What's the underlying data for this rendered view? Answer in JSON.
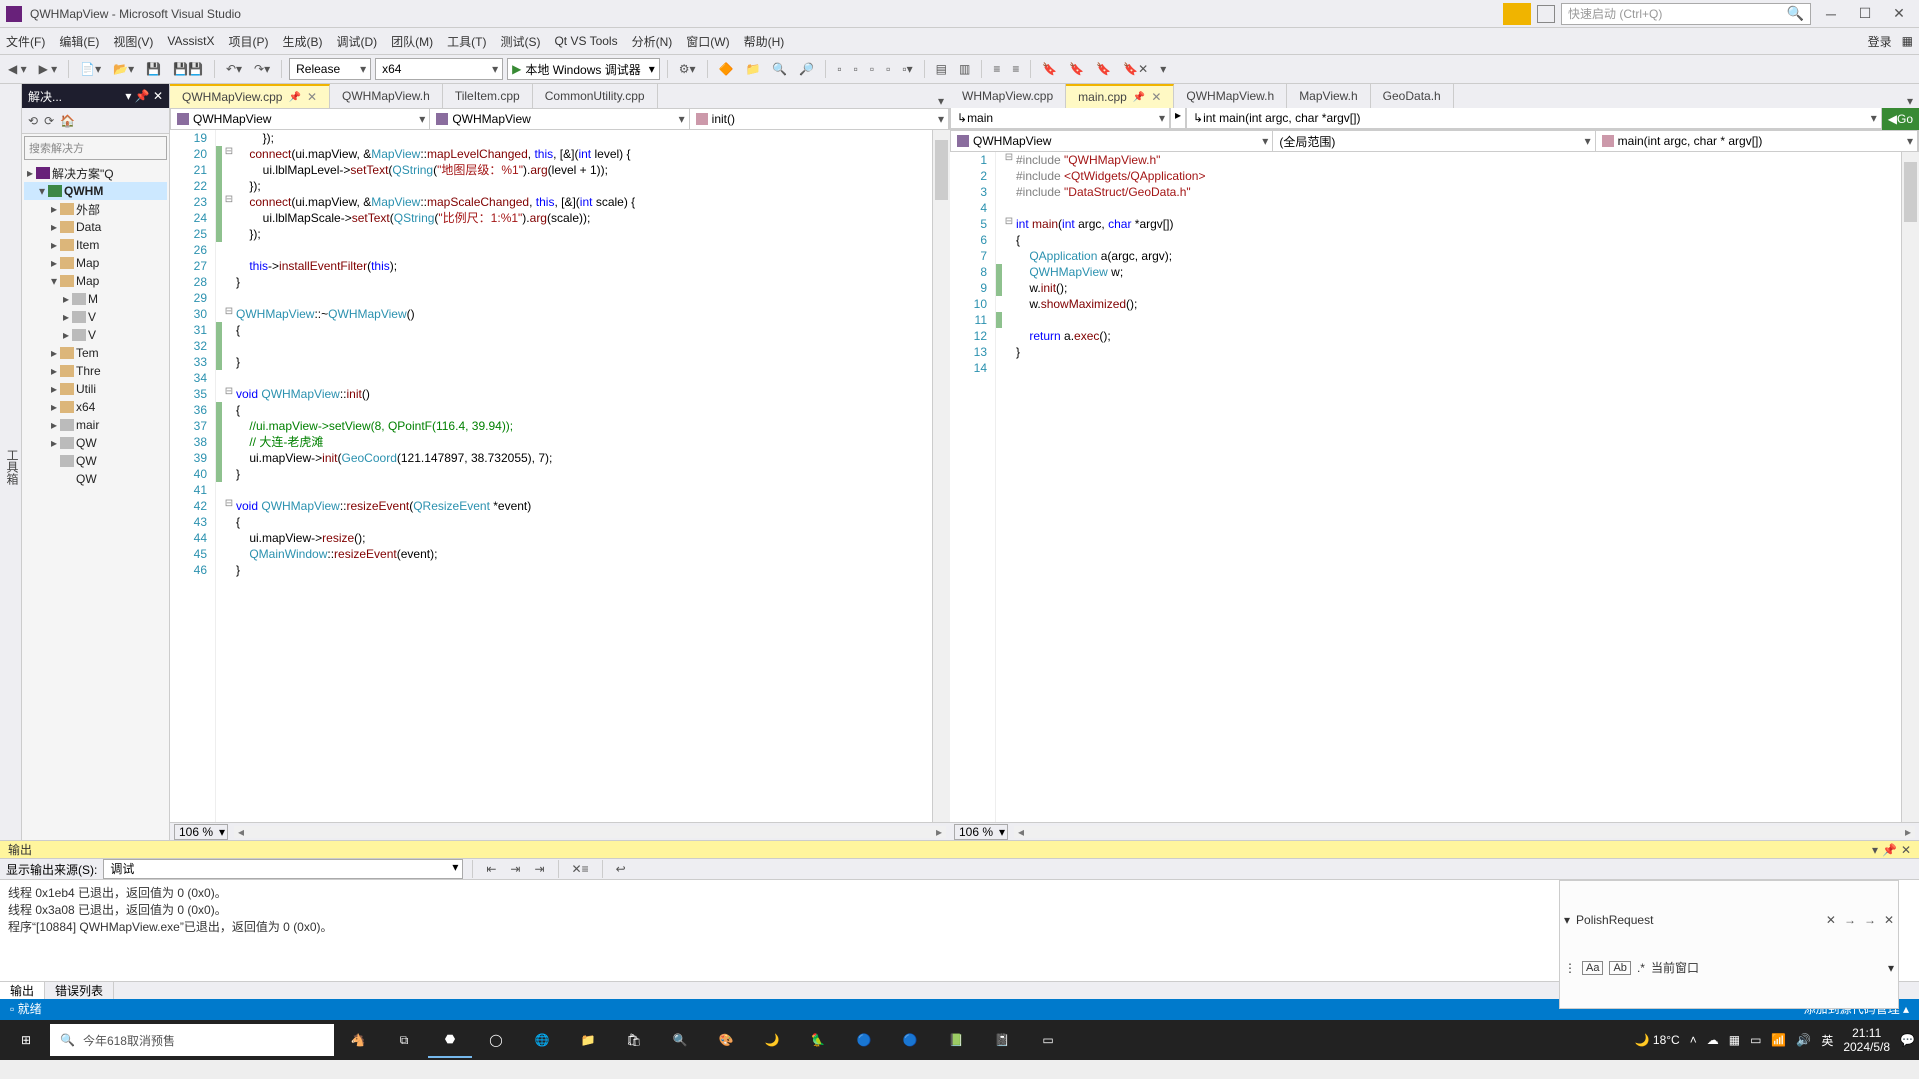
{
  "title": "QWHMapView - Microsoft Visual Studio",
  "quick_launch_placeholder": "快速启动 (Ctrl+Q)",
  "menu": [
    "文件(F)",
    "编辑(E)",
    "视图(V)",
    "VAssistX",
    "项目(P)",
    "生成(B)",
    "调试(D)",
    "团队(M)",
    "工具(T)",
    "测试(S)",
    "Qt VS Tools",
    "分析(N)",
    "窗口(W)",
    "帮助(H)"
  ],
  "login": "登录",
  "toolbar": {
    "config": "Release",
    "platform": "x64",
    "debugger": "本地 Windows 调试器"
  },
  "side_toolbox": "工具箱",
  "solution": {
    "tab": "解决...",
    "search_ph": "搜索解决方",
    "items": [
      {
        "d": 0,
        "exp": "▸",
        "ico": "sln",
        "txt": "解决方案\"Q"
      },
      {
        "d": 1,
        "exp": "▾",
        "ico": "proj",
        "txt": "QWHM",
        "bold": true,
        "sel": true
      },
      {
        "d": 2,
        "exp": "▸",
        "ico": "folder",
        "txt": "外部"
      },
      {
        "d": 2,
        "exp": "▸",
        "ico": "folder",
        "txt": "Data"
      },
      {
        "d": 2,
        "exp": "▸",
        "ico": "folder",
        "txt": "Item"
      },
      {
        "d": 2,
        "exp": "▸",
        "ico": "folder",
        "txt": "Map"
      },
      {
        "d": 2,
        "exp": "▾",
        "ico": "folder",
        "txt": "Map"
      },
      {
        "d": 3,
        "exp": "▸",
        "ico": "file",
        "txt": "M"
      },
      {
        "d": 3,
        "exp": "▸",
        "ico": "file",
        "txt": "V"
      },
      {
        "d": 3,
        "exp": "▸",
        "ico": "file",
        "txt": "V"
      },
      {
        "d": 2,
        "exp": "▸",
        "ico": "folder",
        "txt": "Tem"
      },
      {
        "d": 2,
        "exp": "▸",
        "ico": "folder",
        "txt": "Thre"
      },
      {
        "d": 2,
        "exp": "▸",
        "ico": "folder",
        "txt": "Utili"
      },
      {
        "d": 2,
        "exp": "▸",
        "ico": "folder",
        "txt": "x64"
      },
      {
        "d": 2,
        "exp": "▸",
        "ico": "file",
        "txt": "mair"
      },
      {
        "d": 2,
        "exp": "▸",
        "ico": "file",
        "txt": "QW"
      },
      {
        "d": 2,
        "exp": "",
        "ico": "file",
        "txt": "QW"
      },
      {
        "d": 2,
        "exp": "",
        "ico": "",
        "txt": "QW"
      }
    ]
  },
  "left_editor": {
    "tabs": [
      {
        "label": "QWHMapView.cpp",
        "active": true,
        "pinned": true,
        "close": true
      },
      {
        "label": "QWHMapView.h"
      },
      {
        "label": "TileItem.cpp"
      },
      {
        "label": "CommonUtility.cpp"
      }
    ],
    "nav": [
      "QWHMapView",
      "QWHMapView",
      "init()"
    ],
    "zoom": "106 %",
    "lines": [
      {
        "n": 19,
        "h": "        });"
      },
      {
        "n": 20,
        "cb": "g",
        "fold": "⊟",
        "h": "    <span class='fn'>connect</span>(ui.mapView, &<span class='type'>MapView</span>::<span class='fn'>mapLevelChanged</span>, <span class='kw'>this</span>, [&](<span class='kw'>int</span> level) {"
      },
      {
        "n": 21,
        "cb": "g",
        "h": "        ui.lblMapLevel-&gt;<span class='fn'>setText</span>(<span class='type'>QString</span>(<span class='str'>\"地图层级：%1\"</span>).<span class='fn'>arg</span>(level + 1));"
      },
      {
        "n": 22,
        "cb": "g",
        "h": "    });"
      },
      {
        "n": 23,
        "cb": "g",
        "fold": "⊟",
        "h": "    <span class='fn'>connect</span>(ui.mapView, &<span class='type'>MapView</span>::<span class='fn'>mapScaleChanged</span>, <span class='kw'>this</span>, [&](<span class='kw'>int</span> scale) {"
      },
      {
        "n": 24,
        "cb": "g",
        "h": "        ui.lblMapScale-&gt;<span class='fn'>setText</span>(<span class='type'>QString</span>(<span class='str'>\"比例尺：1:%1\"</span>).<span class='fn'>arg</span>(scale));"
      },
      {
        "n": 25,
        "cb": "g",
        "h": "    });"
      },
      {
        "n": 26,
        "h": ""
      },
      {
        "n": 27,
        "h": "    <span class='kw'>this</span>-&gt;<span class='fn'>installEventFilter</span>(<span class='kw'>this</span>);"
      },
      {
        "n": 28,
        "h": "}"
      },
      {
        "n": 29,
        "h": ""
      },
      {
        "n": 30,
        "fold": "⊟",
        "h": "<span class='type'>QWHMapView</span>::~<span class='type'>QWHMapView</span>()"
      },
      {
        "n": 31,
        "cb": "g",
        "h": "{"
      },
      {
        "n": 32,
        "cb": "g",
        "h": ""
      },
      {
        "n": 33,
        "cb": "g",
        "h": "}"
      },
      {
        "n": 34,
        "h": ""
      },
      {
        "n": 35,
        "fold": "⊟",
        "h": "<span class='kw'>void</span> <span class='type'>QWHMapView</span>::<span class='fn'>init</span>()"
      },
      {
        "n": 36,
        "cb": "g",
        "h": "{"
      },
      {
        "n": 37,
        "cb": "g",
        "h": "    <span class='cmt'>//ui.mapView-&gt;setView(8, QPointF(116.4, 39.94));</span>"
      },
      {
        "n": 38,
        "cb": "g",
        "h": "    <span class='cmt'>// 大连-老虎滩</span>"
      },
      {
        "n": 39,
        "cb": "g",
        "h": "    ui.mapView-&gt;<span class='fn'>init</span>(<span class='type'>GeoCoord</span>(121.147897, 38.732055), 7);"
      },
      {
        "n": 40,
        "cb": "g",
        "h": "}"
      },
      {
        "n": 41,
        "h": ""
      },
      {
        "n": 42,
        "fold": "⊟",
        "h": "<span class='kw'>void</span> <span class='type'>QWHMapView</span>::<span class='fn'>resizeEvent</span>(<span class='type'>QResizeEvent</span> *event)"
      },
      {
        "n": 43,
        "h": "{"
      },
      {
        "n": 44,
        "h": "    ui.mapView-&gt;<span class='fn'>resize</span>();"
      },
      {
        "n": 45,
        "h": "    <span class='type'>QMainWindow</span>::<span class='fn'>resizeEvent</span>(event);"
      },
      {
        "n": 46,
        "h": "}"
      }
    ]
  },
  "right_editor": {
    "tabs": [
      {
        "label": "WHMapView.cpp"
      },
      {
        "label": "main.cpp",
        "active": true,
        "pinned": true,
        "close": true
      },
      {
        "label": "QWHMapView.h"
      },
      {
        "label": "MapView.h"
      },
      {
        "label": "GeoData.h"
      }
    ],
    "top_combo": [
      "main",
      "int main(int argc, char *argv[])"
    ],
    "go": "Go",
    "nav": [
      "QWHMapView",
      "(全局范围)",
      "main(int argc, char * argv[])"
    ],
    "zoom": "106 %",
    "lines": [
      {
        "n": 1,
        "fold": "⊟",
        "h": "<span class='pp'>#include</span> <span class='inc'>\"QWHMapView.h\"</span>"
      },
      {
        "n": 2,
        "h": "<span class='pp'>#include</span> <span class='inc'>&lt;QtWidgets/QApplication&gt;</span>"
      },
      {
        "n": 3,
        "h": "<span class='pp'>#include</span> <span class='inc'>\"DataStruct/GeoData.h\"</span>"
      },
      {
        "n": 4,
        "h": ""
      },
      {
        "n": 5,
        "fold": "⊟",
        "h": "<span class='kw'>int</span> <span class='fn'>main</span>(<span class='kw'>int</span> argc, <span class='kw'>char</span> *argv[])"
      },
      {
        "n": 6,
        "h": "{"
      },
      {
        "n": 7,
        "h": "    <span class='type'>QApplication</span> a(argc, argv);"
      },
      {
        "n": 8,
        "cb": "g",
        "h": "    <span class='type'>QWHMapView</span> w;"
      },
      {
        "n": 9,
        "cb": "g",
        "h": "    w.<span class='fn'>init</span>();"
      },
      {
        "n": 10,
        "h": "    w.<span class='fn'>showMaximized</span>();"
      },
      {
        "n": 11,
        "cb": "g",
        "h": ""
      },
      {
        "n": 12,
        "h": "    <span class='kw'>return</span> a.<span class='fn'>exec</span>();"
      },
      {
        "n": 13,
        "h": "}"
      },
      {
        "n": 14,
        "h": ""
      }
    ]
  },
  "output": {
    "title": "输出",
    "source_label": "显示输出来源(S):",
    "source_value": "调试",
    "lines": [
      "线程 0x1eb4 已退出，返回值为 0 (0x0)。",
      "线程 0x3a08 已退出，返回值为 0 (0x0)。",
      "程序“[10884] QWHMapView.exe”已退出，返回值为 0 (0x0)。"
    ],
    "tabs": [
      "输出",
      "错误列表"
    ]
  },
  "polish": {
    "title": "PolishRequest",
    "scope_label": "当前窗口"
  },
  "status": {
    "left": "就绪",
    "right": "添加到源代码管理 ▴"
  },
  "taskbar": {
    "search": "今年618取消预售",
    "weather": "18°C",
    "ime": "英",
    "time": "21:11",
    "date": "2024/5/8"
  }
}
